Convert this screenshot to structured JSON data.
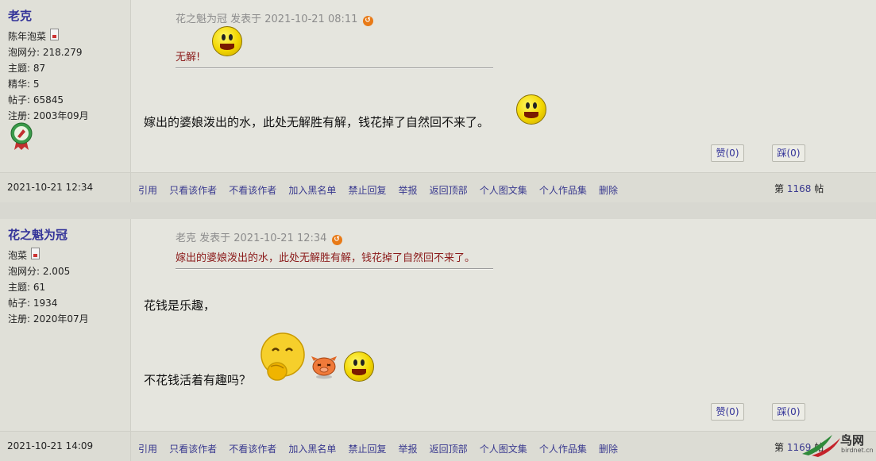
{
  "posts": [
    {
      "author": "老克",
      "stats": [
        "陈年泡菜",
        "泡网分: 218.279",
        "主题: 87",
        "精华: 5",
        "帖子: 65845",
        "注册: 2003年09月"
      ],
      "quote_meta": "花之魁为冠 发表于 2021-10-21 08:11",
      "quote_text": "无解!",
      "body": [
        "嫁出的婆娘泼出的水，此处无解胜有解，钱花掉了自然回不来了。"
      ],
      "like_label": "赞(0)",
      "dislike_label": "踩(0)",
      "date": "2021-10-21 12:34",
      "floor_prefix": "第",
      "floor_number": "1168",
      "floor_suffix": "帖"
    },
    {
      "author": "花之魁为冠",
      "stats": [
        "泡菜",
        "泡网分: 2.005",
        "主题: 61",
        "帖子: 1934",
        "注册: 2020年07月"
      ],
      "quote_meta": "老克 发表于 2021-10-21 12:34",
      "quote_text": "嫁出的婆娘泼出的水，此处无解胜有解，钱花掉了自然回不来了。",
      "body": [
        "花钱是乐趣，",
        "不花钱活着有趣吗？"
      ],
      "like_label": "赞(0)",
      "dislike_label": "踩(0)",
      "date": "2021-10-21 14:09",
      "floor_prefix": "第",
      "floor_number": "1169",
      "floor_suffix": "帖"
    }
  ],
  "actions": [
    "引用",
    "只看该作者",
    "不看该作者",
    "加入黑名单",
    "禁止回复",
    "举报",
    "返回顶部",
    "个人图文集",
    "个人作品集",
    "删除"
  ],
  "watermark": {
    "text": "鸟网",
    "sub": "birdnet.cn"
  },
  "colors": {
    "author": "#333399",
    "link": "#3a3a8f",
    "quote_text": "#8b1a1a",
    "arrow": "#e87a17"
  }
}
